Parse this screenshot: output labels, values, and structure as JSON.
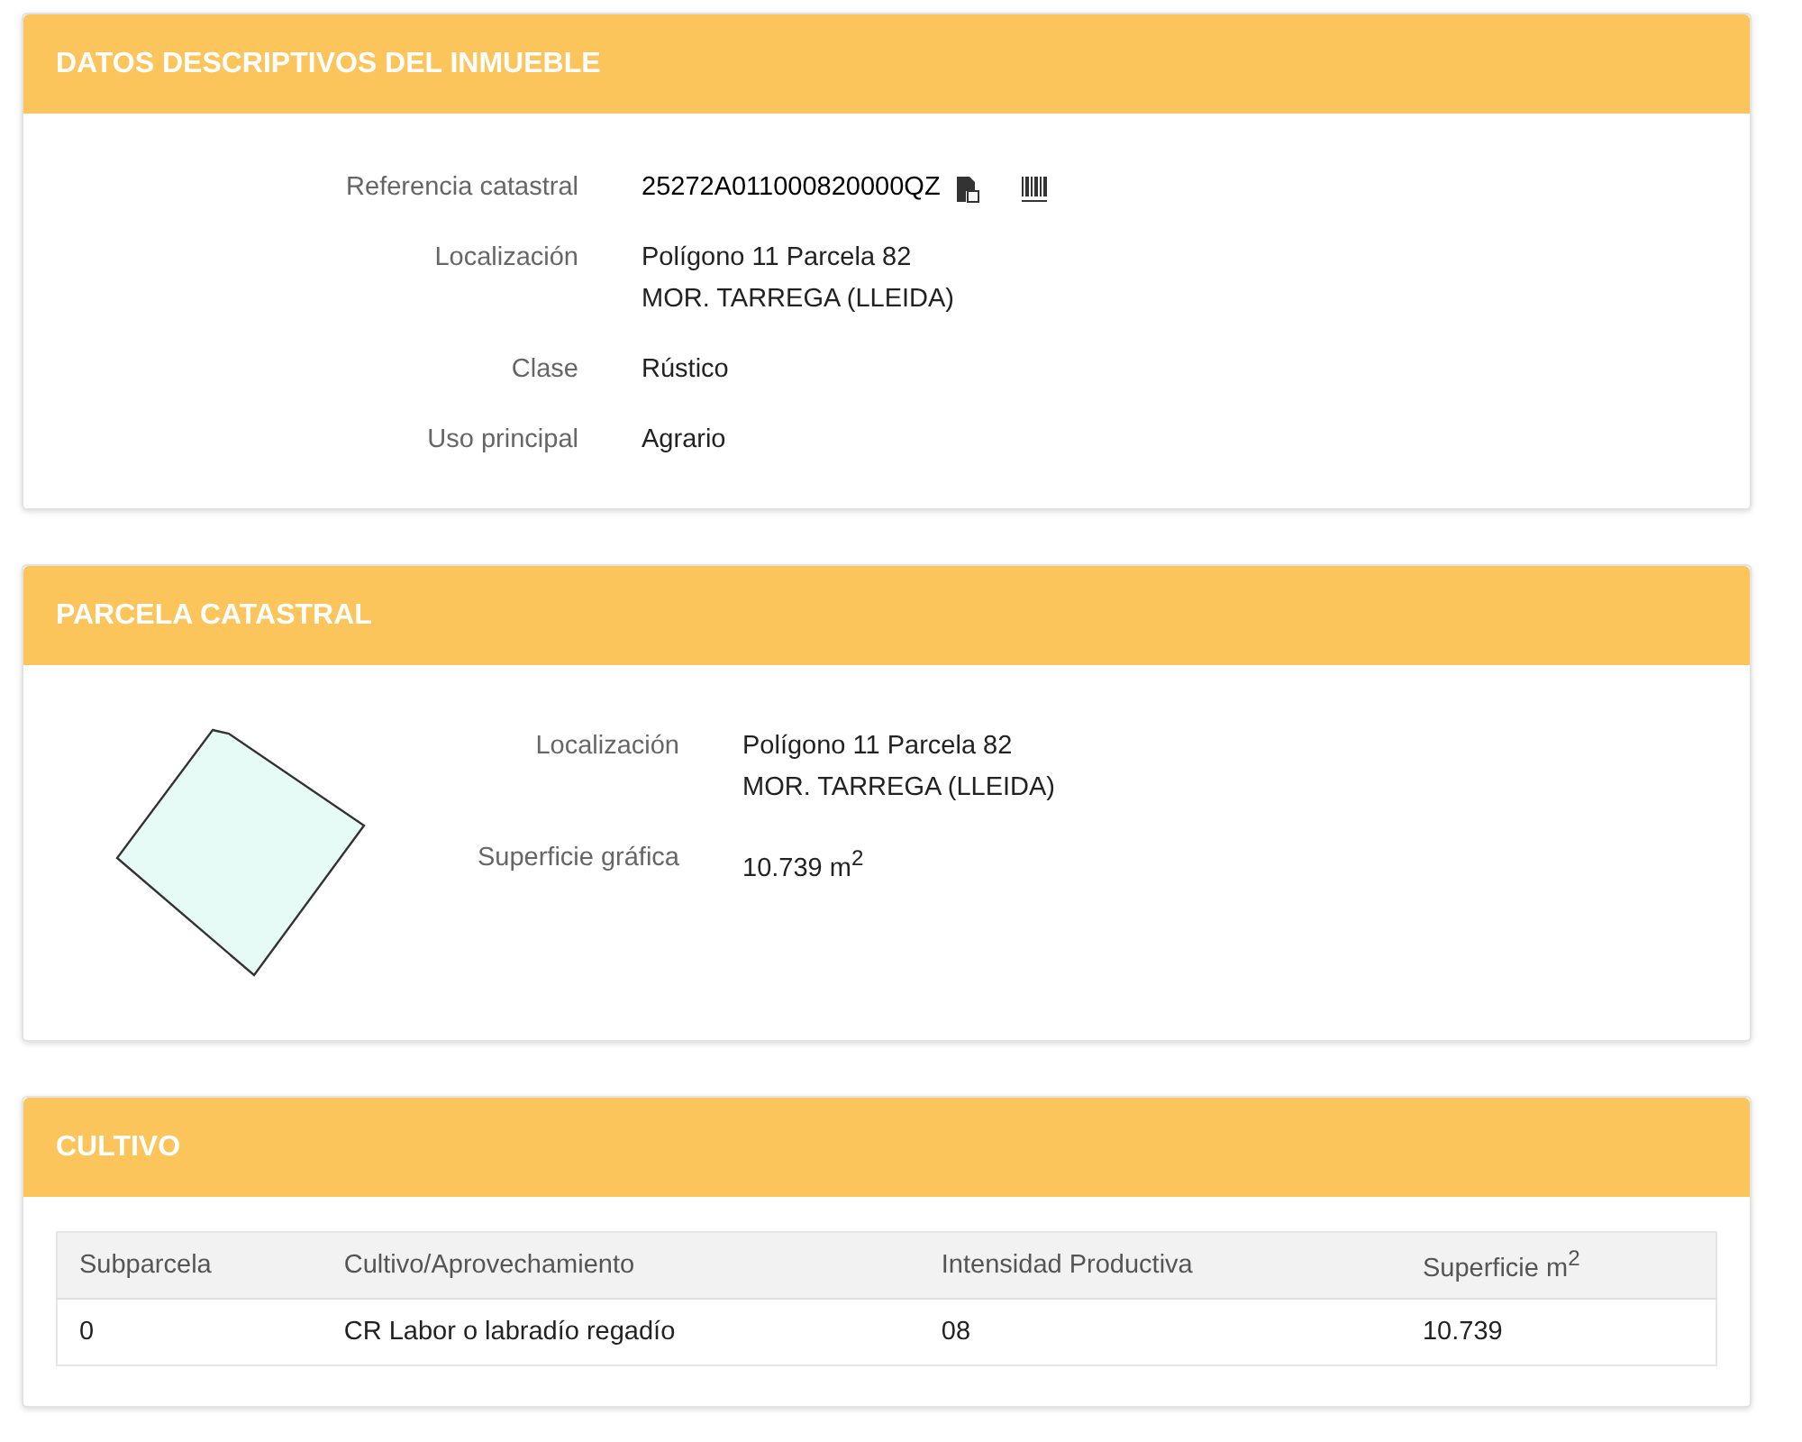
{
  "descriptive": {
    "title": "DATOS DESCRIPTIVOS DEL INMUEBLE",
    "fields": [
      {
        "kind": "reference",
        "label": "Referencia catastral",
        "lines": [
          "25272A011000820000QZ"
        ]
      },
      {
        "kind": "plain",
        "label": "Localización",
        "lines": [
          "Polígono 11 Parcela 82",
          "MOR. TARREGA (LLEIDA)"
        ]
      },
      {
        "kind": "plain",
        "label": "Clase",
        "lines": [
          "Rústico"
        ]
      },
      {
        "kind": "plain",
        "label": "Uso principal",
        "lines": [
          "Agrario"
        ]
      }
    ]
  },
  "parcel": {
    "title": "PARCELA CATASTRAL",
    "fields": [
      {
        "kind": "plain",
        "label": "Localización",
        "lines": [
          "Polígono 11 Parcela 82",
          "MOR. TARREGA (LLEIDA)"
        ]
      },
      {
        "kind": "plain",
        "label": "Superficie gráfica",
        "lines": [
          "10.739 m$^{2}$"
        ]
      }
    ]
  },
  "crop": {
    "title": "CULTIVO",
    "table": {
      "columns": [
        "Subparcela",
        "Cultivo/Aprovechamiento",
        "Intensidad Productiva",
        "Superficie m$^{2}$"
      ],
      "rows": [
        [
          "0",
          "CR Labor o labradío regadío",
          "08",
          "10.739"
        ]
      ]
    }
  }
}
